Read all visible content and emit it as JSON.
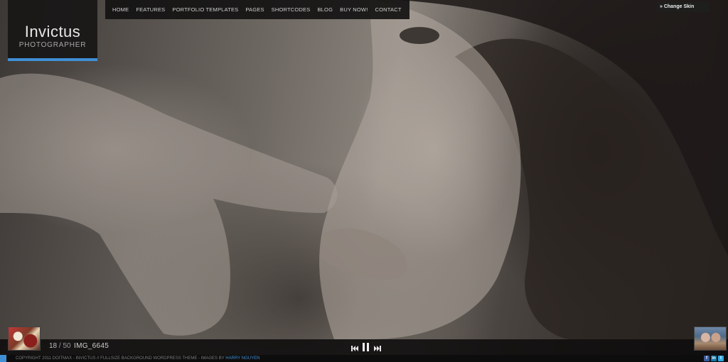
{
  "logo": {
    "name": "Invictus",
    "tagline": "PHOTOGRAPHER"
  },
  "nav": {
    "items": [
      "HOME",
      "FEATURES",
      "PORTFOLIO TEMPLATES",
      "PAGES",
      "SHORTCODES",
      "BLOG",
      "BUY NOW!",
      "CONTACT"
    ]
  },
  "skin": {
    "label": "» Change Skin"
  },
  "slideshow": {
    "current": "18",
    "separator": "/",
    "total": "50",
    "image_name": "IMG_6645",
    "prev_icon": "previous-icon",
    "pause_icon": "pause-icon",
    "next_icon": "next-icon"
  },
  "footer": {
    "copyright": "COPYRIGHT 2011 DOITMAX - INVICTUS // FULLSIZE BACKGROUND WORDPRESS THEME - IMAGES BY",
    "credit_link": "HARRY NGUYEN",
    "social": [
      {
        "icon": "facebook-icon",
        "label": "f",
        "color": "#3b5998"
      },
      {
        "icon": "linkedin-icon",
        "label": "in",
        "color": "#0e76a8"
      },
      {
        "icon": "twitter-icon",
        "label": "t",
        "color": "#2fa9e0"
      }
    ]
  },
  "colors": {
    "accent": "#3f8fd4",
    "bar": "#0e0c0c"
  }
}
